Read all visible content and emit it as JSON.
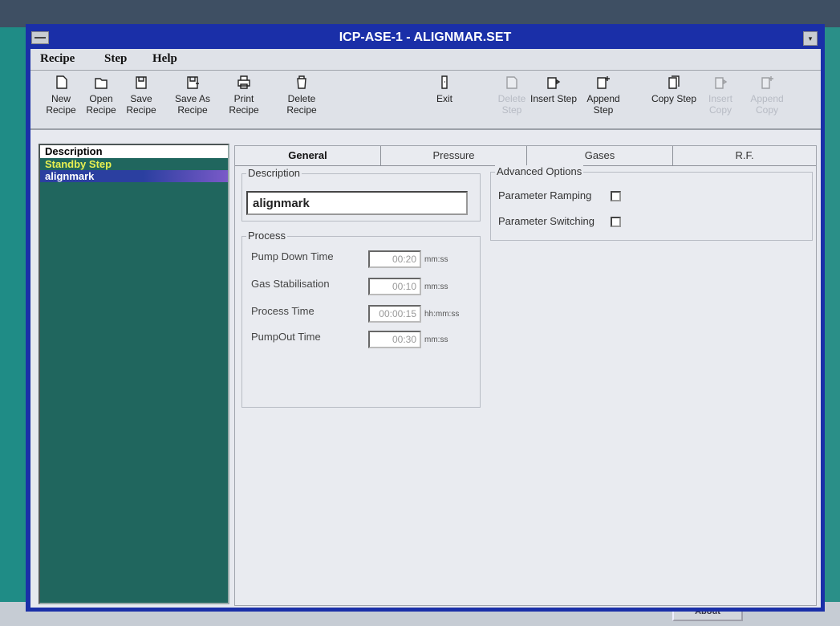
{
  "window": {
    "title": "ICP-ASE-1 - ALIGNMAR.SET"
  },
  "menu": [
    "Recipe",
    "Step",
    "Help"
  ],
  "toolbar": [
    {
      "label": "New Recipe",
      "icon": "new-recipe-icon",
      "enabled": true
    },
    {
      "label": "Open Recipe",
      "icon": "open-recipe-icon",
      "enabled": true
    },
    {
      "label": "Save Recipe",
      "icon": "save-recipe-icon",
      "enabled": true
    },
    {
      "label": "Save As Recipe",
      "icon": "save-as-recipe-icon",
      "enabled": true
    },
    {
      "label": "Print Recipe",
      "icon": "print-recipe-icon",
      "enabled": true
    },
    {
      "label": "Delete Recipe",
      "icon": "delete-recipe-icon",
      "enabled": true
    },
    {
      "label": "Exit",
      "icon": "exit-icon",
      "enabled": true
    },
    {
      "label": "Delete Step",
      "icon": "delete-step-icon",
      "enabled": false
    },
    {
      "label": "Insert Step",
      "icon": "insert-step-icon",
      "enabled": true
    },
    {
      "label": "Append Step",
      "icon": "append-step-icon",
      "enabled": true
    },
    {
      "label": "Copy Step",
      "icon": "copy-step-icon",
      "enabled": true
    },
    {
      "label": "Insert Copy",
      "icon": "insert-copy-icon",
      "enabled": false
    },
    {
      "label": "Append Copy",
      "icon": "append-copy-icon",
      "enabled": false
    }
  ],
  "tree": {
    "header": "Description",
    "items": [
      "Standby Step",
      "alignmark"
    ],
    "selected": "alignmark"
  },
  "tabs": [
    "General",
    "Pressure",
    "Gases",
    "R.F."
  ],
  "active_tab": "General",
  "general": {
    "description_label": "Description",
    "description_value": "alignmark",
    "process_label": "Process",
    "process_rows": [
      {
        "label": "Pump Down Time",
        "value": "00:20",
        "unit": "mm:ss"
      },
      {
        "label": "Gas Stabilisation",
        "value": "00:10",
        "unit": "mm:ss"
      },
      {
        "label": "Process Time",
        "value": "00:00:15",
        "unit": "hh:mm:ss"
      },
      {
        "label": "PumpOut Time",
        "value": "00:30",
        "unit": "mm:ss"
      }
    ],
    "advanced_label": "Advanced Options",
    "parameter_ramping_label": "Parameter Ramping",
    "parameter_ramping_checked": false,
    "parameter_switching_label": "Parameter Switching",
    "parameter_switching_checked": false
  },
  "background": {
    "about_label": "About"
  }
}
